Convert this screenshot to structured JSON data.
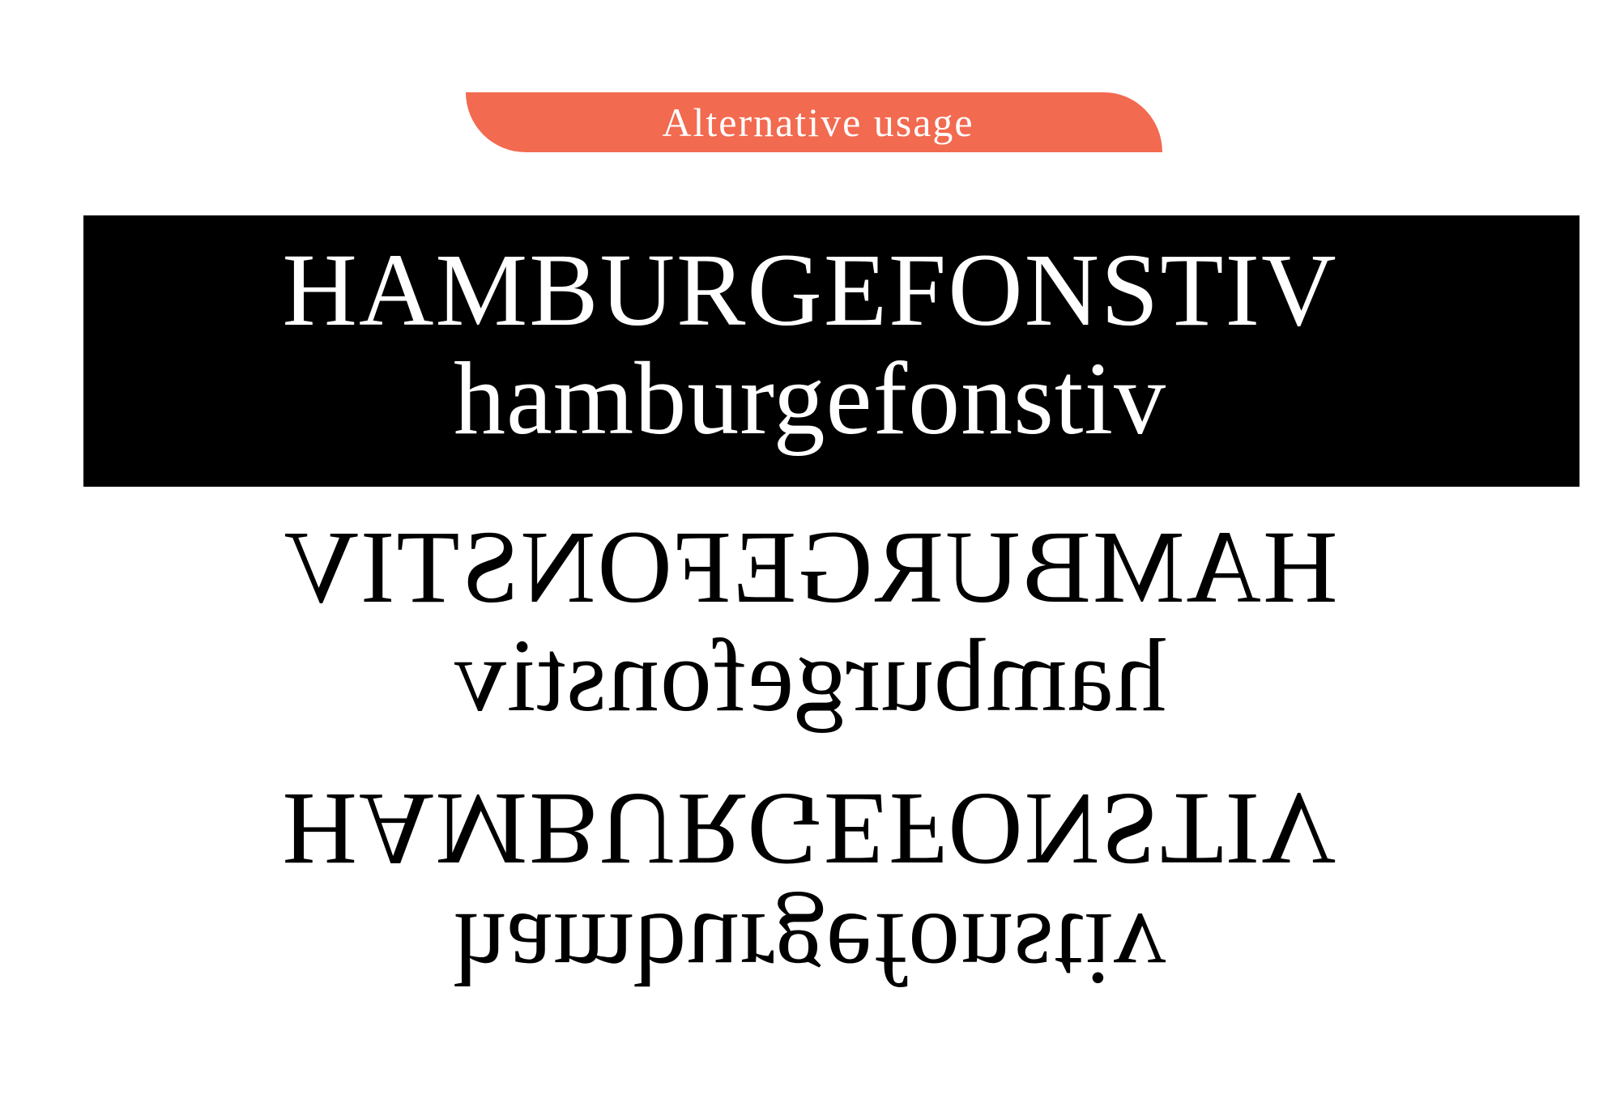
{
  "header": {
    "tab_label": "Alternative usage",
    "tab_color": "#f26a4f"
  },
  "specimen": {
    "uppercase": "HAMBURGEFONSTIV",
    "lowercase": "hamburgefonstiv",
    "band_color": "#000000"
  },
  "rows": [
    {
      "uppercase": "HAMBURGEFONSTIV",
      "lowercase": "hamburgefonstiv",
      "treatment": "inverted white on black"
    },
    {
      "uppercase": "HAMBURGEFONSTIV",
      "lowercase": "hamburgefonstiv",
      "treatment": "mirrored horizontally"
    },
    {
      "uppercase": "HAMBURGEFONSTIV",
      "lowercase": "hamburgefonstiv",
      "treatment": "flipped vertically"
    }
  ]
}
